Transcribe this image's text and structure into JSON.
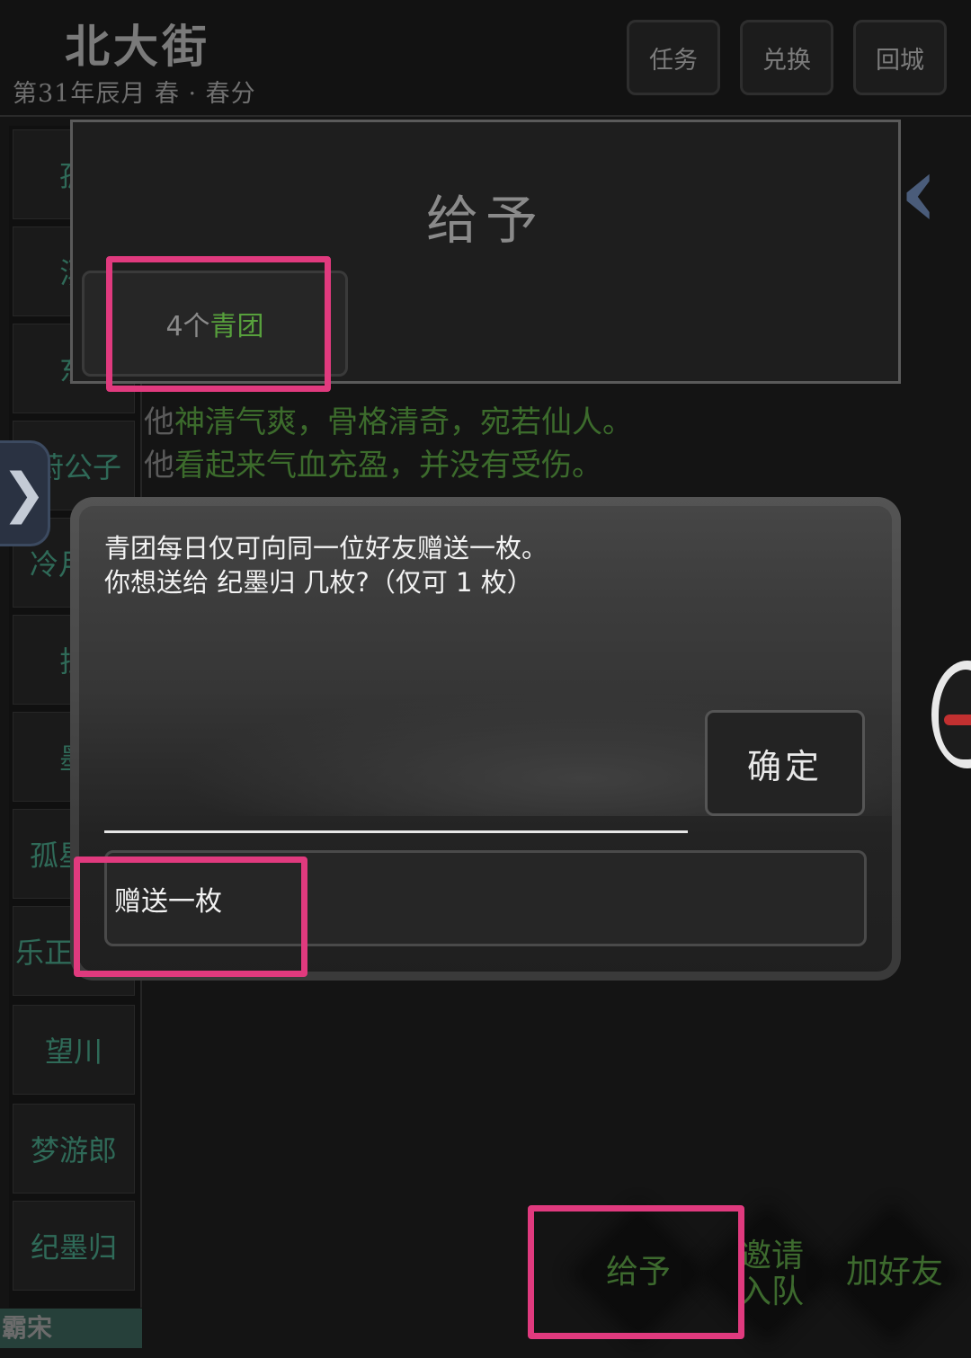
{
  "header": {
    "location": "北大街",
    "date": "第31年辰月  春 · 春分",
    "buttons": [
      "任务",
      "兑换",
      "回城"
    ]
  },
  "left_list": {
    "items": [
      "孤",
      "汤",
      "东",
      "蔚公子",
      "冷月",
      "拉",
      "墨",
      "孤星",
      "乐正",
      "望川",
      "梦游郎",
      "纪墨归"
    ],
    "bottom": "霸宋"
  },
  "description": {
    "line1_prefix": "他",
    "line1_green": "神清气爽，骨格清奇，宛若仙人。",
    "line2_prefix": "他",
    "line2_green": "看起来气血充盈，并没有受伤。"
  },
  "give_panel": {
    "title": "给予",
    "item_count": "4个",
    "item_name": "青团"
  },
  "dialog": {
    "line1": "青团每日仅可向同一位好友赠送一枚。",
    "line2": "你想送给 纪墨归 几枚?（仅可 1 枚）",
    "confirm": "确定",
    "gift_one": "赠送一枚"
  },
  "actions": {
    "give": "给予",
    "invite_line1": "邀请",
    "invite_line2": "入队",
    "add_friend": "加好友"
  },
  "colors": {
    "highlight": "#e03a7e",
    "green_text": "#57a03c",
    "teal_text": "#2f6a58"
  },
  "icons": {
    "close": "close-icon",
    "expand": "chevron-right-icon",
    "avatar": "penguin-avatar-icon"
  }
}
